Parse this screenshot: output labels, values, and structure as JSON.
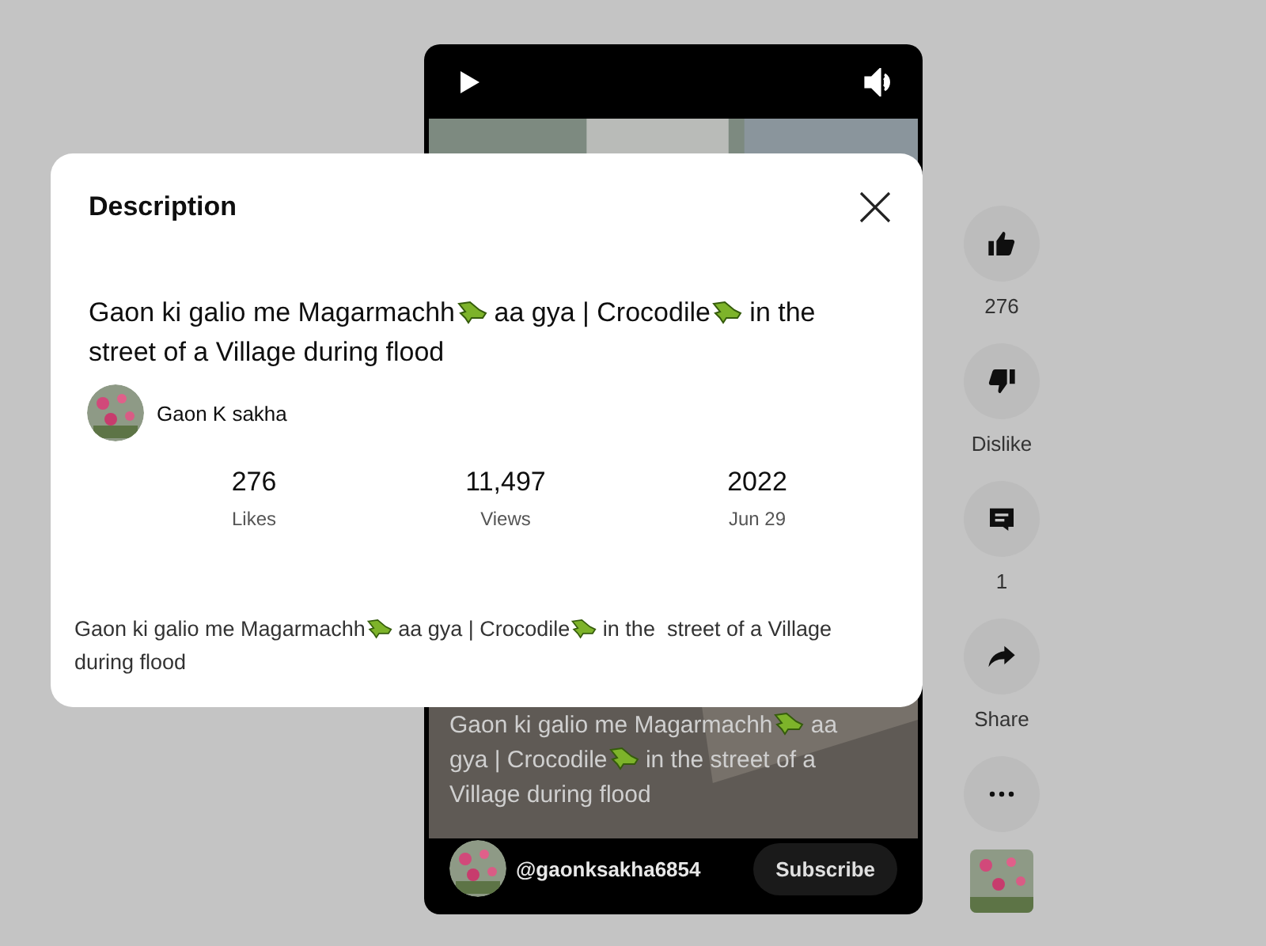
{
  "player": {
    "title_parts": [
      "Gaon ki galio me Magarmachh",
      " aa gya | Crocodile",
      " in the street of a Village during flood"
    ],
    "channel_handle": "@gaonksakha6854",
    "subscribe_button": "Subscribe"
  },
  "actions": [
    {
      "kind": "like",
      "label": "276"
    },
    {
      "kind": "dislike",
      "label": "Dislike"
    },
    {
      "kind": "comment",
      "label": "1"
    },
    {
      "kind": "share",
      "label": "Share"
    },
    {
      "kind": "more"
    }
  ],
  "description_dialog": {
    "heading": "Description",
    "title_parts": [
      "Gaon ki galio me Magarmachh",
      " aa gya | Crocodile",
      " in the street of a Village during flood"
    ],
    "channel_name": "Gaon K sakha",
    "stats": [
      {
        "value": "276",
        "label": "Likes"
      },
      {
        "value": "11,497",
        "label": "Views"
      },
      {
        "value": "2022",
        "label": "Jun 29"
      }
    ],
    "body_parts": [
      "Gaon ki galio me Magarmachh",
      " aa gya | Crocodile",
      " in the  street of a Village during flood"
    ]
  }
}
